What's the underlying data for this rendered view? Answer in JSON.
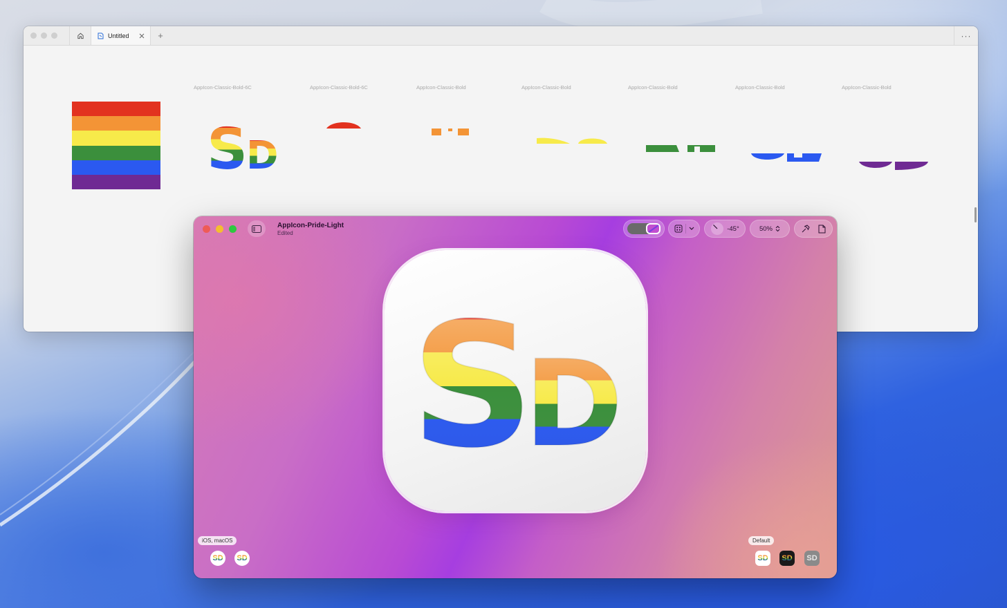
{
  "browser": {
    "tab_title": "Untitled",
    "new_tab_label": "+",
    "more_label": "···",
    "layer_labels": [
      "AppIcon-Classic-Bold-6C",
      "AppIcon-Classic-Bold-6C",
      "AppIcon-Classic-Bold",
      "AppIcon-Classic-Bold",
      "AppIcon-Classic-Bold",
      "AppIcon-Classic-Bold",
      "AppIcon-Classic-Bold"
    ],
    "flag_colors": [
      "#e2321f",
      "#f39436",
      "#f7ea4a",
      "#3b8f3c",
      "#2b59f0",
      "#6f2a93"
    ]
  },
  "app": {
    "title": "AppIcon-Pride-Light",
    "subtitle": "Edited",
    "angle": "-45°",
    "zoom": "50%",
    "glyph_text": "SD",
    "platform_label": "iOS, macOS",
    "variant_label": "Default",
    "traffic_lights": [
      "#ee5b57",
      "#f5bd2f",
      "#2fc840"
    ],
    "icons": {
      "sidebar": "sidebar-toggle-icon",
      "appearance": "appearance-toggle-icon",
      "grid": "grid-icon",
      "chevron": "chevron-down-icon",
      "inspector": "hammer-icon",
      "document": "document-icon"
    }
  }
}
